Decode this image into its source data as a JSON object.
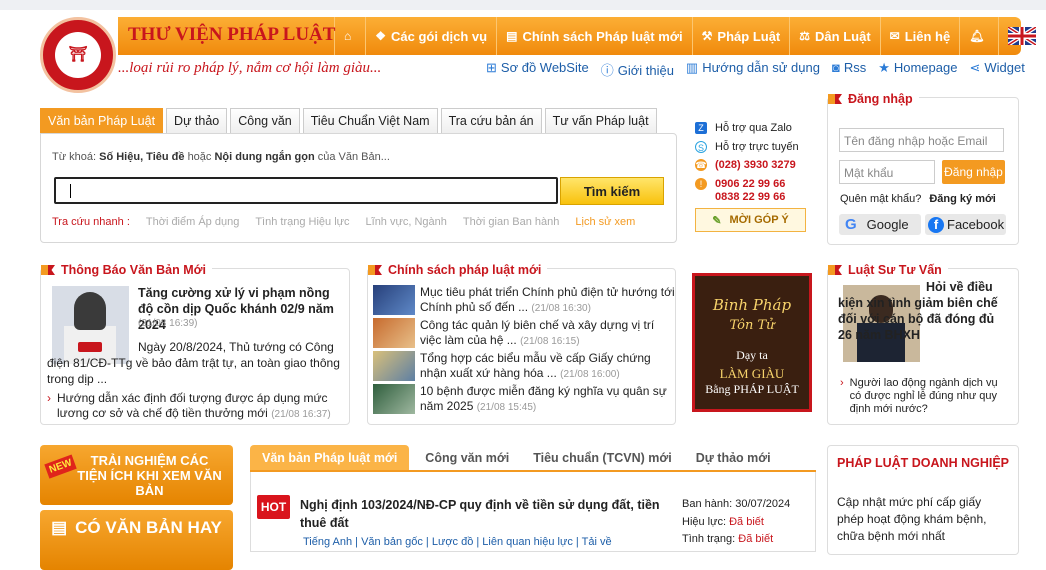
{
  "header": {
    "site_title": "THƯ VIỆN PHÁP LUẬT",
    "slogan": "...loại rủi ro pháp lý, nắm cơ hội làm giàu...",
    "nav": [
      {
        "icon": "home-icon",
        "label": ""
      },
      {
        "icon": "dropbox-icon",
        "label": "Các gói dịch vụ"
      },
      {
        "icon": "book-icon",
        "label": "Chính sách Pháp luật mới"
      },
      {
        "icon": "gavel-icon",
        "label": "Pháp Luật"
      },
      {
        "icon": "scale-icon",
        "label": "Dân Luật"
      },
      {
        "icon": "envelope-icon",
        "label": "Liên hệ"
      },
      {
        "icon": "bell-icon",
        "label": ""
      },
      {
        "icon": "uk-flag-icon",
        "label": ""
      }
    ],
    "subnav": [
      "Sơ đồ WebSite",
      "Giới thiệu",
      "Hướng dẫn sử dụng",
      "Rss",
      "Homepage",
      "Widget"
    ]
  },
  "search": {
    "tabs": [
      "Văn bản Pháp Luật",
      "Dự thảo",
      "Công văn",
      "Tiêu Chuẩn Việt Nam",
      "Tra cứu bản án",
      "Tư vấn Pháp luật"
    ],
    "hint_pre": "Từ khoá:",
    "hint_b1": "Số Hiệu, Tiêu đề",
    "hint_mid": "hoặc",
    "hint_b2": "Nội dung ngắn gọn",
    "hint_post": "của Văn Bản...",
    "button": "Tìm kiếm",
    "quick_label": "Tra cứu nhanh :",
    "quick": [
      "Thời điểm Áp dụng",
      "Tình trạng Hiệu lực",
      "Lĩnh vực, Ngành",
      "Thời gian Ban hành"
    ],
    "history": "Lịch sử xem"
  },
  "support": {
    "zalo": "Hỗ trợ qua Zalo",
    "online": "Hỗ trợ trực tuyến",
    "phone1": "(028) 3930 3279",
    "phone2": "0906 22 99 66",
    "phone3": "0838 22 99 66",
    "feedback": "MỜI GÓP Ý"
  },
  "login": {
    "title": "Đăng nhập",
    "user_placeholder": "Tên đăng nhập hoặc Email",
    "pass_placeholder": "Mật khẩu",
    "button": "Đăng nhập",
    "forgot": "Quên mật khẩu?",
    "register": "Đăng ký mới",
    "google": "Google",
    "facebook": "Facebook"
  },
  "notices": {
    "title": "Thông Báo Văn Bản Mới",
    "headline": "Tăng cường xử lý vi phạm nồng độ cồn dịp Quốc khánh 02/9 năm 2024",
    "headline_time": "(21/08 16:39)",
    "summary": "Ngày 20/8/2024, Thủ tướng có Công điện 81/CĐ-TTg về bảo đảm trật tự, an toàn giao thông trong dịp ...",
    "item": "Hướng dẫn xác định đối tượng được áp dụng mức lương cơ sở và chế độ tiền thưởng mới",
    "item_time": "(21/08 16:37)"
  },
  "policy": {
    "title": "Chính sách pháp luật mới",
    "items": [
      {
        "text": "Mục tiêu phát triển Chính phủ điện tử hướng tới Chính phủ số đến ...",
        "time": "(21/08 16:30)"
      },
      {
        "text": "Công tác quản lý biên chế và xây dựng vị trí việc làm của hệ ...",
        "time": "(21/08 16:15)"
      },
      {
        "text": "Tổng hợp các biểu mẫu về cấp Giấy chứng nhận xuất xứ hàng hóa ...",
        "time": "(21/08 16:00)"
      },
      {
        "text": "10 bệnh được miễn đăng ký nghĩa vụ quân sự năm 2025",
        "time": "(21/08 15:45)"
      }
    ]
  },
  "banner": {
    "l1": "Binh Pháp",
    "l2": "Tôn Tử",
    "l3": "Dạy ta",
    "l4": "LÀM GIÀU",
    "l5": "Bằng PHÁP LUẬT"
  },
  "lawyer": {
    "title": "Luật Sư Tư Vấn",
    "headline": "Hỏi về điều kiện xin tình giảm biên chế đối với cán bộ đã đóng đủ 26 năm BHXH",
    "item": "Người lao động ngành dịch vụ có được nghỉ lễ đúng như quy định mới nước?"
  },
  "promos": [
    "TRẢI NGHIỆM CÁC TIỆN ÍCH KHI XEM VĂN BẢN",
    "CÓ VĂN BẢN HAY"
  ],
  "promo_badge": "NEW",
  "docs": {
    "tabs": [
      "Văn bản Pháp luật mới",
      "Công văn mới",
      "Tiêu chuẩn (TCVN) mới",
      "Dự thảo mới"
    ],
    "hot": "HOT",
    "title": "Nghị định 103/2024/NĐ-CP quy định về tiền sử dụng đất, tiền thuê đất",
    "issued_label": "Ban hành:",
    "issued": "30/07/2024",
    "effect_label": "Hiệu lực:",
    "effect": "Đã biết",
    "status_label": "Tình trạng:",
    "status": "Đã biết",
    "links": "Tiếng Anh | Văn bản gốc | Lược đồ | Liên quan hiệu lực | Tải về"
  },
  "business": {
    "title": "PHÁP LUẬT DOANH NGHIỆP",
    "text": "Cập nhật mức phí cấp giấy phép hoạt động khám bệnh, chữa bệnh mới nhất"
  }
}
